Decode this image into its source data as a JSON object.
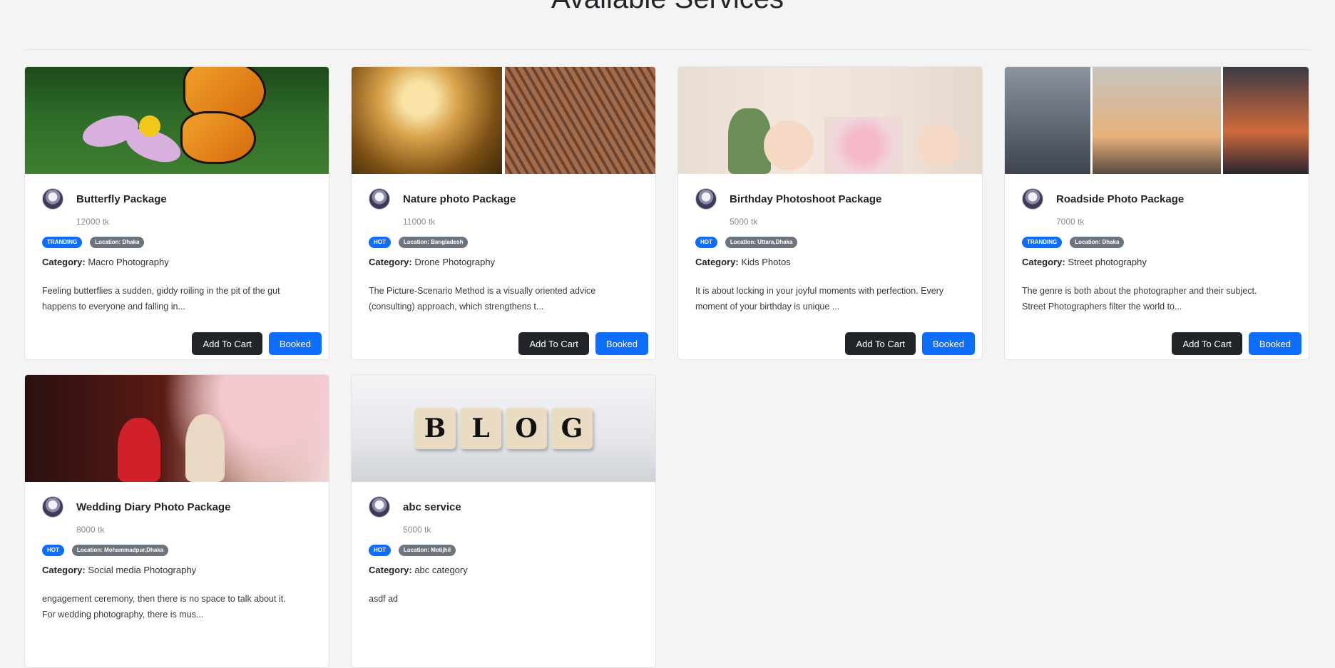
{
  "page": {
    "title": "Available Services"
  },
  "cards": [
    {
      "title": "Butterfly Package",
      "price": "12000 tk",
      "badge": "TRANDING",
      "location": "Location: Dhaka",
      "category_label": "Category:",
      "category": "Macro Photography",
      "description": "Feeling butterflies a sudden, giddy roiling in the pit of the gut happens to everyone and falling in...",
      "add_to_cart": "Add To Cart",
      "booked": "Booked"
    },
    {
      "title": "Nature photo Package",
      "price": "11000 tk",
      "badge": "HOT",
      "location": "Location: Bangladesh",
      "category_label": "Category:",
      "category": "Drone Photography",
      "description": "The Picture-Scenario Method is a visually oriented advice (consulting) approach, which strengthens t...",
      "add_to_cart": "Add To Cart",
      "booked": "Booked"
    },
    {
      "title": "Birthday Photoshoot Package",
      "price": "5000 tk",
      "badge": "HOT",
      "location": "Location: Uttara,Dhaka",
      "category_label": "Category:",
      "category": "Kids Photos",
      "description": "It is about locking in your joyful moments with perfection. Every moment of your birthday is unique ...",
      "add_to_cart": "Add To Cart",
      "booked": "Booked"
    },
    {
      "title": "Roadside Photo Package",
      "price": "7000 tk",
      "badge": "TRANDING",
      "location": "Location: Dhaka",
      "category_label": "Category:",
      "category": "Street photography",
      "description": "The genre is both about the photographer and their subject. Street Photographers filter the world to...",
      "add_to_cart": "Add To Cart",
      "booked": "Booked"
    },
    {
      "title": "Wedding Diary Photo Package",
      "price": "8000 tk",
      "badge": "HOT",
      "location": "Location: Mohammadpur,Dhaka",
      "category_label": "Category:",
      "category": "Social media Photography",
      "description": "engagement ceremony, then there is no space to talk about it. For wedding photography, there is mus..."
    },
    {
      "title": "abc service",
      "price": "5000 tk",
      "badge": "HOT",
      "location": "Location: Motijhil",
      "category_label": "Category:",
      "category": "abc category",
      "description": "asdf ad"
    }
  ],
  "images": {
    "blog_letters": [
      "B",
      "L",
      "O",
      "G"
    ]
  },
  "colors": {
    "primary": "#0d6efd",
    "dark": "#212529",
    "badge_location": "#6c757d"
  }
}
